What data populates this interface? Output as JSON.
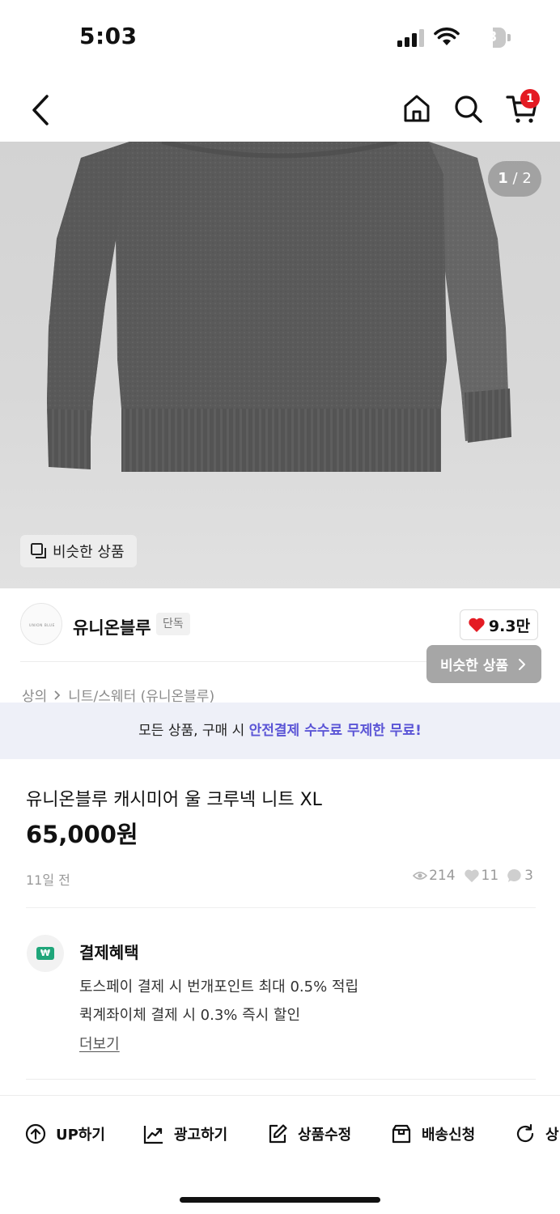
{
  "status_bar": {
    "time": "5:03",
    "battery": "63"
  },
  "nav": {
    "cart_badge": "1"
  },
  "image": {
    "counter_current": "1",
    "counter_sep": "/",
    "counter_total": "2",
    "similar_chip": "비슷한 상품"
  },
  "seller": {
    "name": "유니온블루",
    "tag": "단독",
    "like_count": "9.3만",
    "similar_button": "비슷한 상품"
  },
  "breadcrumb": [
    "상의",
    "니트/스웨터 (유니온블루)"
  ],
  "notice": {
    "text": "모든 상품, 구매 시 ",
    "highlight": "안전결제 수수료 무제한 무료!"
  },
  "product": {
    "title": "유니온블루 캐시미어 울 크루넥 니트 XL",
    "price": "65,000원",
    "posted": "11일 전",
    "views": "214",
    "likes": "11",
    "chats": "3"
  },
  "benefits": {
    "title": "결제혜택",
    "line1": "토스페이 결제 시 번개포인트 최대 0.5% 적립",
    "line2": "퀵계좌이체 결제 시 0.3% 즉시 할인",
    "more": "더보기"
  },
  "actions": {
    "up": "UP하기",
    "ad": "광고하기",
    "edit": "상품수정",
    "shipping": "배송신청",
    "status": "상"
  },
  "colors": {
    "accent": "#5b55d6",
    "badge": "#e41b23",
    "heart": "#e41b23",
    "pay_icon": "#1fa67a"
  }
}
